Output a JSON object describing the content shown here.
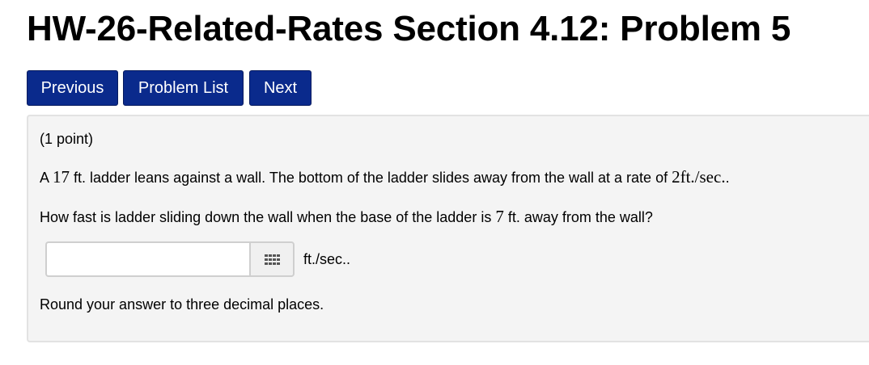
{
  "page": {
    "title": "HW-26-Related-Rates Section 4.12: Problem 5"
  },
  "nav": {
    "previous_label": "Previous",
    "problem_list_label": "Problem List",
    "next_label": "Next"
  },
  "problem": {
    "points": "(1 point)",
    "statement": {
      "part1": "A ",
      "ladder_length": "17",
      "part2": " ft. ladder leans against a wall. The bottom of the ladder slides away from the wall at a rate of ",
      "rate": "2ft./sec.",
      "part3": "."
    },
    "question": {
      "part1": "How fast is ladder sliding down the wall when the base of the ladder is ",
      "distance": "7",
      "part2": " ft. away from the wall?"
    },
    "answer": {
      "value": "",
      "placeholder": "",
      "unit": "ft./sec.."
    },
    "instruction": "Round your answer to three decimal places."
  },
  "colors": {
    "nav_button_bg": "#0a2a8c",
    "nav_button_text": "#ffffff",
    "problem_box_bg": "#f4f4f4",
    "problem_box_border": "#e2e2e2"
  },
  "icons": {
    "keypad": "keypad-grid-icon"
  }
}
